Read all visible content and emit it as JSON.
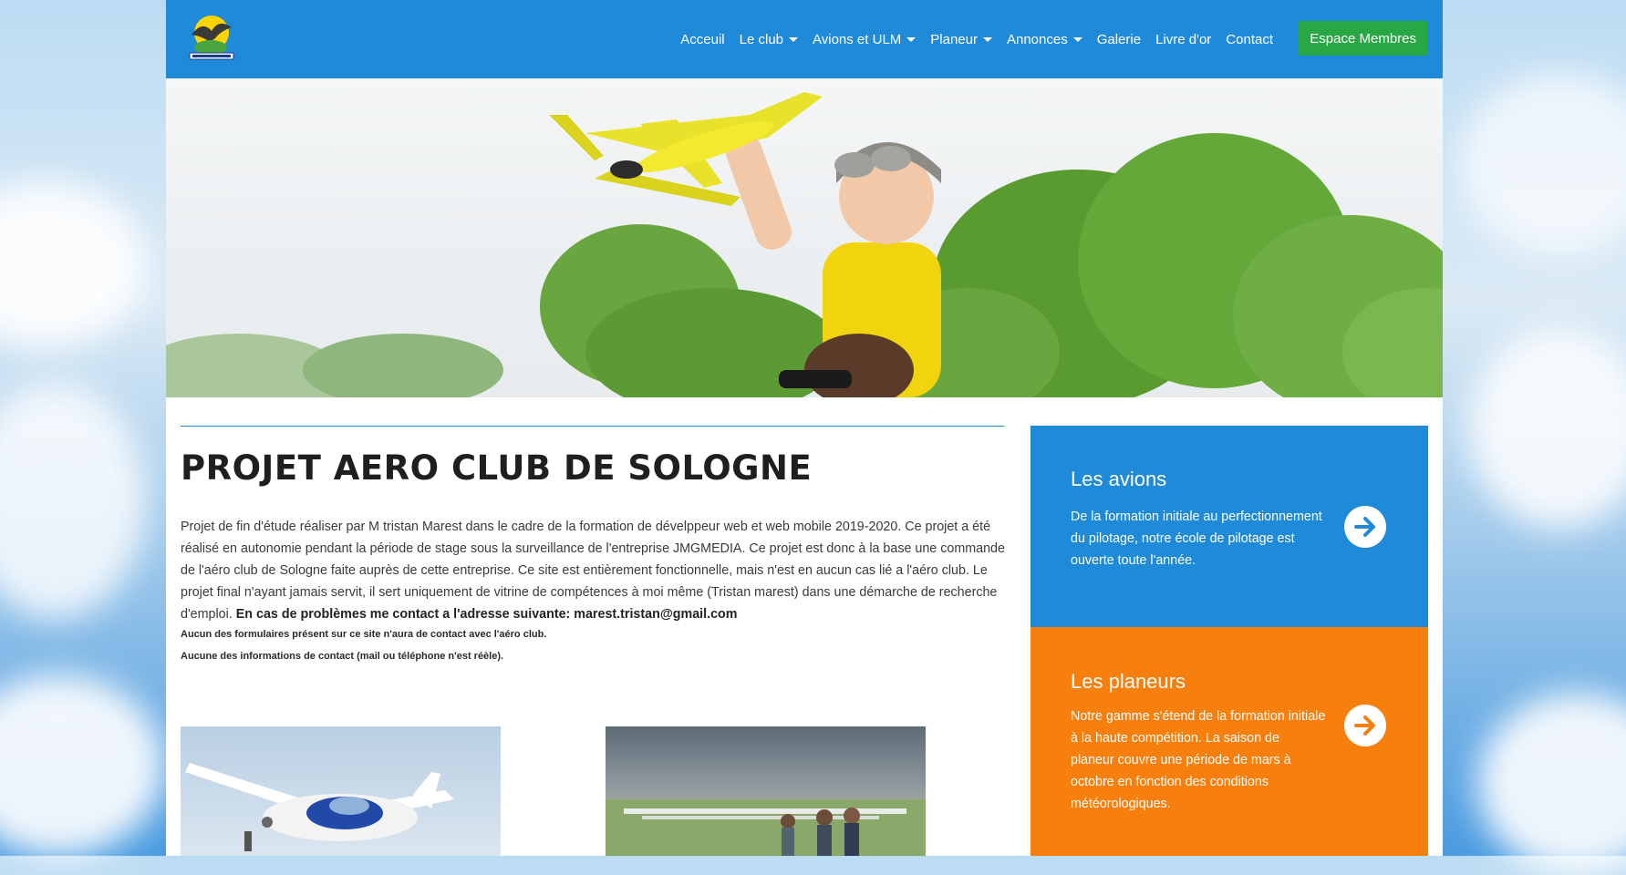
{
  "nav": {
    "items": [
      {
        "label": "Acceuil",
        "dropdown": false
      },
      {
        "label": "Le club",
        "dropdown": true
      },
      {
        "label": "Avions et ULM",
        "dropdown": true
      },
      {
        "label": "Planeur",
        "dropdown": true
      },
      {
        "label": "Annonces",
        "dropdown": true
      },
      {
        "label": "Galerie",
        "dropdown": false
      },
      {
        "label": "Livre d'or",
        "dropdown": false
      },
      {
        "label": "Contact",
        "dropdown": false
      }
    ],
    "members_button": "Espace Membres"
  },
  "main": {
    "title": "PROJET AERO CLUB DE SOLOGNE",
    "intro_text": "Projet de fin d'étude réaliser par M tristan Marest dans le cadre de la formation de dévelppeur web et web mobile 2019-2020. Ce projet a été réalisé en autonomie pendant la période de stage sous la surveillance de l'entreprise JMGMEDIA. Ce projet est donc à la base une commande de l'aéro club de Sologne faite auprès de cette entreprise. Ce site est entièrement fonctionnelle, mais n'est en aucun cas lié a l'aéro club. Le projet final n'ayant jamais servit, il sert uniquement de vitrine de compétences à moi même (Tristan marest) dans une démarche de recherche d'emploi.",
    "contact_text": "En cas de problèmes me contact a l'adresse suivante: marest.tristan@gmail.com",
    "note_1": "Aucun des formulaires présent sur ce site n'aura de contact avec l'aéro club.",
    "note_2": "Aucune des informations de contact (mail ou téléphone n'est réèle)."
  },
  "cards": [
    {
      "title": "Les avions",
      "text": "De la formation initiale au perfectionnement du pilotage, notre école de pilotage est ouverte toute l'année.",
      "color": "#1f8ad7",
      "icon": "arrow-right-circle-icon"
    },
    {
      "title": "Les planeurs",
      "text": "Notre gamme s'étend de la formation initiale à la haute compétition. La saison de planeur couvre une période de mars à octobre en fonction des conditions météorologiques.",
      "color": "#f77f0e",
      "icon": "arrow-right-circle-icon"
    }
  ],
  "colors": {
    "navbar": "#1f8ad7",
    "members_button": "#27a845",
    "card_blue": "#1f8ad7",
    "card_orange": "#f77f0e"
  }
}
